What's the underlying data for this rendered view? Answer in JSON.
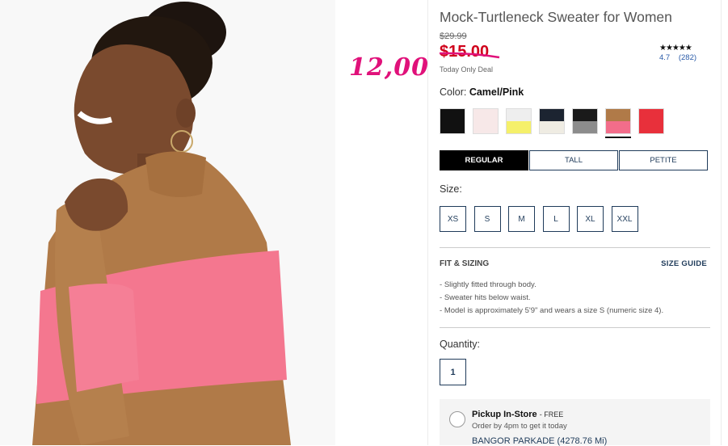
{
  "product": {
    "title": "Mock-Turtleneck Sweater for Women",
    "original_price": "$29.99",
    "sale_price": "$15.00",
    "deal_label": "Today Only Deal",
    "rating": {
      "stars": "★★★★★",
      "score": "4.7",
      "count": "(282)"
    }
  },
  "annotation": {
    "handwritten_price": "12,00"
  },
  "color": {
    "label": "Color:",
    "selected": "Camel/Pink",
    "swatches": [
      {
        "name": "black",
        "colors": [
          "#111111"
        ]
      },
      {
        "name": "light-pink",
        "colors": [
          "#f7e8e8"
        ]
      },
      {
        "name": "yellow-grey",
        "colors": [
          "#eeeeee",
          "#f5f06a"
        ]
      },
      {
        "name": "navy-cream",
        "colors": [
          "#1c2431",
          "#efece3"
        ]
      },
      {
        "name": "black-grey",
        "colors": [
          "#1a1a1a",
          "#8c8c8c"
        ]
      },
      {
        "name": "camel-pink",
        "colors": [
          "#b07a48",
          "#f26d8a"
        ]
      },
      {
        "name": "red",
        "colors": [
          "#e8303b"
        ]
      }
    ],
    "selected_index": 5
  },
  "fit_tabs": [
    "REGULAR",
    "TALL",
    "PETITE"
  ],
  "size": {
    "label": "Size:",
    "options": [
      "XS",
      "S",
      "M",
      "L",
      "XL",
      "XXL"
    ]
  },
  "fit_sizing": {
    "heading": "FIT & SIZING",
    "guide_link": "SIZE GUIDE",
    "bullets": [
      "Slightly fitted through body.",
      "Sweater hits below waist.",
      "Model is approximately 5'9\" and wears a size S (numeric size 4)."
    ]
  },
  "quantity": {
    "label": "Quantity:",
    "value": "1"
  },
  "pickup": {
    "title": "Pickup In-Store",
    "free": "- FREE",
    "subtitle": "Order by 4pm to get it today",
    "store": "BANGOR PARKADE  (4278.76 Mi)"
  },
  "colors": {
    "sale": "#d0021b",
    "accent": "#1f3b5a",
    "annotation": "#e0117a"
  }
}
